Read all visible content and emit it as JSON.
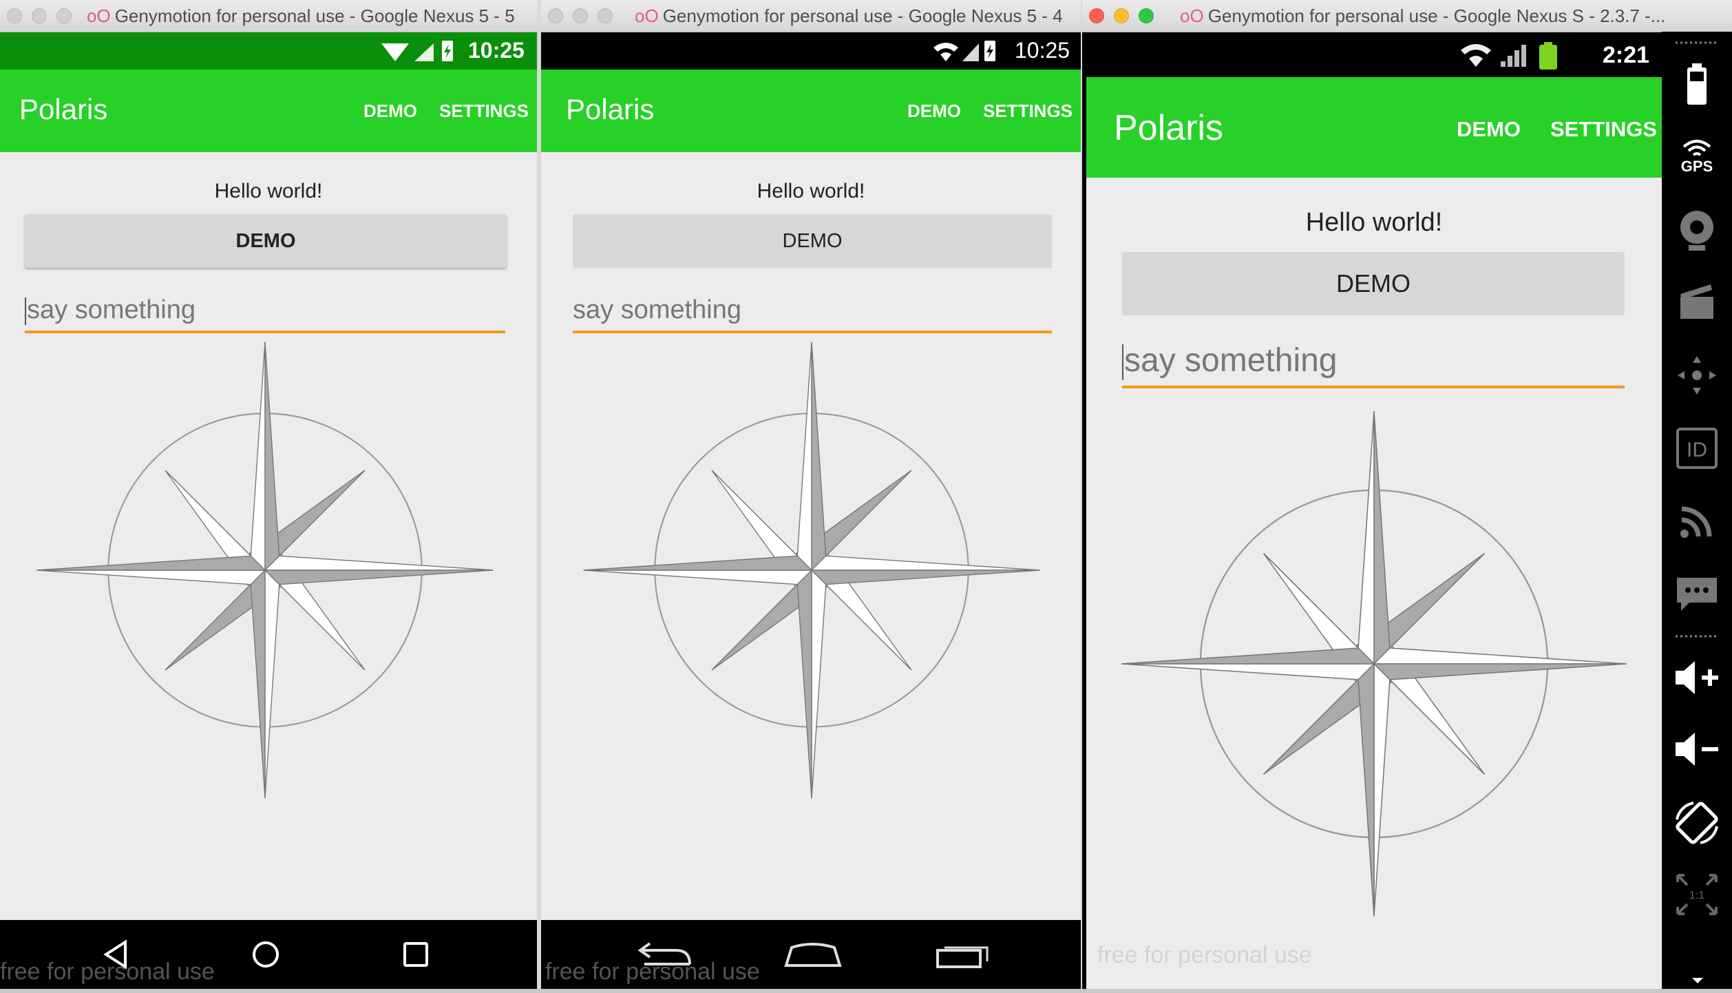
{
  "windows": [
    {
      "title": "Genymotion for personal use - Google Nexus 5 - 5",
      "status_time": "10:25",
      "nav_style": "lollipop",
      "button_bold": true,
      "has_caret": true
    },
    {
      "title": "Genymotion for personal use - Google Nexus 5 - 4",
      "status_time": "10:25",
      "nav_style": "kitkat",
      "button_bold": false,
      "has_caret": false
    },
    {
      "title": "Genymotion for personal use - Google Nexus S - 2.3.7 -...",
      "status_time": "2:21",
      "nav_style": "gingerbread",
      "button_bold": false,
      "has_caret": true
    }
  ],
  "app": {
    "title": "Polaris",
    "actions": [
      "DEMO",
      "SETTINGS"
    ],
    "hello": "Hello world!",
    "button_label": "DEMO",
    "input_placeholder": "say something"
  },
  "watermark": "free for personal use",
  "side_panel": {
    "icons": [
      "battery-icon",
      "gps-icon",
      "webcam-icon",
      "screencast-icon",
      "remote-control-icon",
      "device-id-icon",
      "network-icon",
      "sms-icon",
      "volume-up-icon",
      "volume-down-icon",
      "rotate-icon",
      "pixel-perfect-icon"
    ],
    "gps_label": "GPS",
    "id_label": "ID",
    "scale_label": "1:1"
  },
  "colors": {
    "action_bar": "#27d127",
    "input_underline": "#f39c12",
    "compass_fill_dark": "#aaaaaa",
    "compass_fill_light": "#ffffff"
  }
}
